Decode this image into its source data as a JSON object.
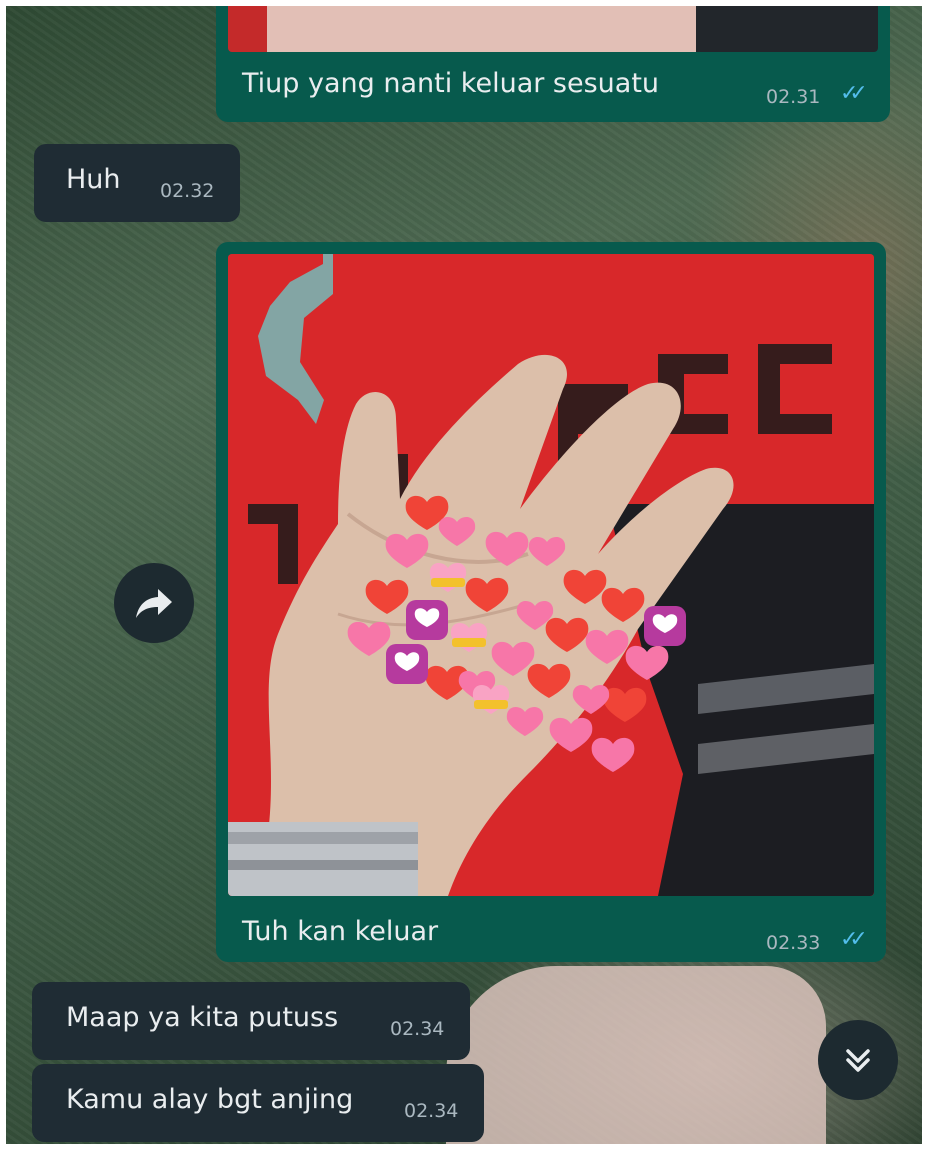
{
  "messages": [
    {
      "id": "m1",
      "direction": "outgoing",
      "text": "Tiup yang nanti keluar sesuatu",
      "time": "02.31",
      "status": "read"
    },
    {
      "id": "m2",
      "direction": "incoming",
      "text": "Huh",
      "time": "02.32"
    },
    {
      "id": "m3",
      "direction": "outgoing",
      "type": "image",
      "caption": "Tuh kan keluar",
      "time": "02.33",
      "status": "read"
    },
    {
      "id": "m4",
      "direction": "incoming",
      "text": "Maap ya kita putuss",
      "time": "02.34"
    },
    {
      "id": "m5",
      "direction": "incoming",
      "text": "Kamu alay bgt anjing",
      "time": "02.34"
    }
  ],
  "icons": {
    "read_ticks": "double-check-icon",
    "forward": "forward-icon",
    "scroll_down": "double-chevron-down-icon"
  },
  "colors": {
    "outgoing_bubble": "#075a4d",
    "incoming_bubble": "#1f2c34",
    "read_tick": "#53bdeb",
    "text": "#e9edef",
    "timestamp": "#aab8c0",
    "photo_shirt": "#d8282a",
    "hearts_red": "#f04437",
    "hearts_pink": "#f776a8"
  }
}
